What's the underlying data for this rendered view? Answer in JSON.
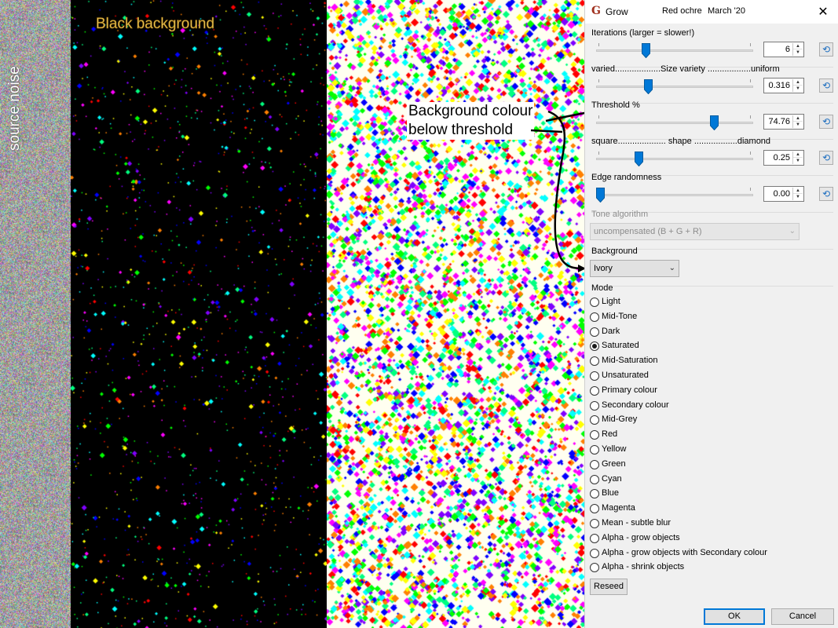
{
  "image_panels": {
    "source_label": "source noise",
    "black_label": "Black background",
    "annotation_line1": "Background colour",
    "annotation_line2": "below threshold"
  },
  "dialog": {
    "title": "Grow",
    "subtitle": "Red ochre",
    "date": "March '20",
    "close_glyph": "✕",
    "app_icon_glyph": "G",
    "reset_glyph": "⟲",
    "sliders": [
      {
        "label": "Iterations (larger = slower!)",
        "value": "6",
        "fraction": 0.3
      },
      {
        "label": "varied...................Size variety ..................uniform",
        "value": "0.316",
        "fraction": 0.316
      },
      {
        "label": "Threshold %",
        "value": "74.76",
        "fraction": 0.7476
      },
      {
        "label": "square.................... shape ..................diamond",
        "value": "0.25",
        "fraction": 0.25
      },
      {
        "label": "Edge randomness",
        "value": "0.00",
        "fraction": 0.0
      }
    ],
    "tone": {
      "label": "Tone algorithm",
      "value": "uncompensated (B + G + R)",
      "enabled": false
    },
    "background": {
      "label": "Background",
      "value": "Ivory"
    },
    "mode": {
      "label": "Mode",
      "selected": "Saturated",
      "options": [
        "Light",
        "Mid-Tone",
        "Dark",
        "Saturated",
        "Mid-Saturation",
        "Unsaturated",
        "Primary colour",
        "Secondary colour",
        "Mid-Grey",
        "Red",
        "Yellow",
        "Green",
        "Cyan",
        "Blue",
        "Magenta",
        "Mean - subtle blur",
        "Alpha - grow objects",
        "Alpha - grow objects with Secondary colour",
        "Alpha - shrink objects"
      ]
    },
    "reseed_label": "Reseed",
    "ok_label": "OK",
    "cancel_label": "Cancel"
  },
  "colors": {
    "dialog_bg": "#f0f0f0",
    "slider_thumb": "#0078d7",
    "ivory": "#fffff0",
    "label_gold": "#e8c85a",
    "icon_red": "#a0301e"
  }
}
